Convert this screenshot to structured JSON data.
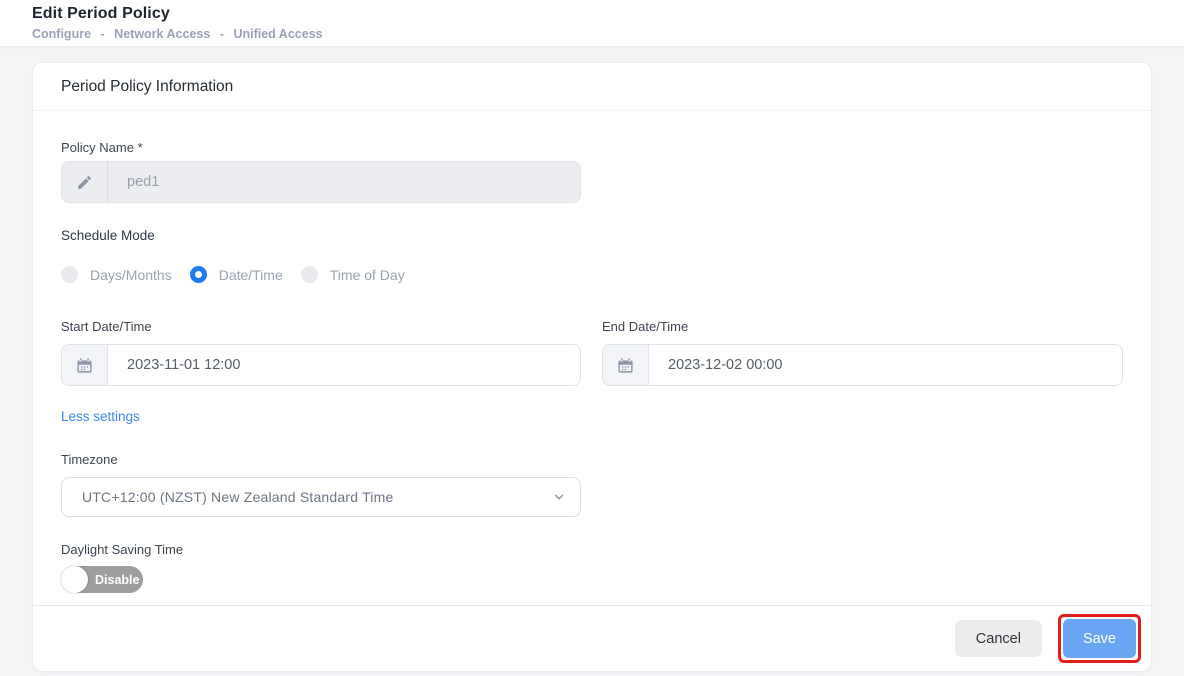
{
  "header": {
    "title": "Edit Period Policy",
    "breadcrumb": [
      "Configure",
      "Network Access",
      "Unified Access"
    ],
    "separator": "-"
  },
  "card": {
    "title": "Period Policy Information"
  },
  "policy_name": {
    "label": "Policy Name *",
    "value": "ped1"
  },
  "schedule_mode": {
    "label": "Schedule Mode",
    "options": [
      {
        "label": "Days/Months",
        "selected": false
      },
      {
        "label": "Date/Time",
        "selected": true
      },
      {
        "label": "Time of Day",
        "selected": false
      }
    ]
  },
  "start_datetime": {
    "label": "Start Date/Time",
    "value": "2023-11-01 12:00"
  },
  "end_datetime": {
    "label": "End Date/Time",
    "value": "2023-12-02 00:00"
  },
  "less_settings_link": "Less settings",
  "timezone": {
    "label": "Timezone",
    "value": "UTC+12:00 (NZST) New Zealand Standard Time"
  },
  "daylight_saving": {
    "label": "Daylight Saving Time",
    "state": "Disable",
    "enabled": false
  },
  "footer": {
    "cancel_label": "Cancel",
    "save_label": "Save"
  },
  "colors": {
    "accent_blue": "#1e7bf2",
    "link_blue": "#3d87f6",
    "save_blue": "#69a5f3",
    "annotation_red": "#e0201d",
    "toggle_gray": "#9e9e9e"
  }
}
